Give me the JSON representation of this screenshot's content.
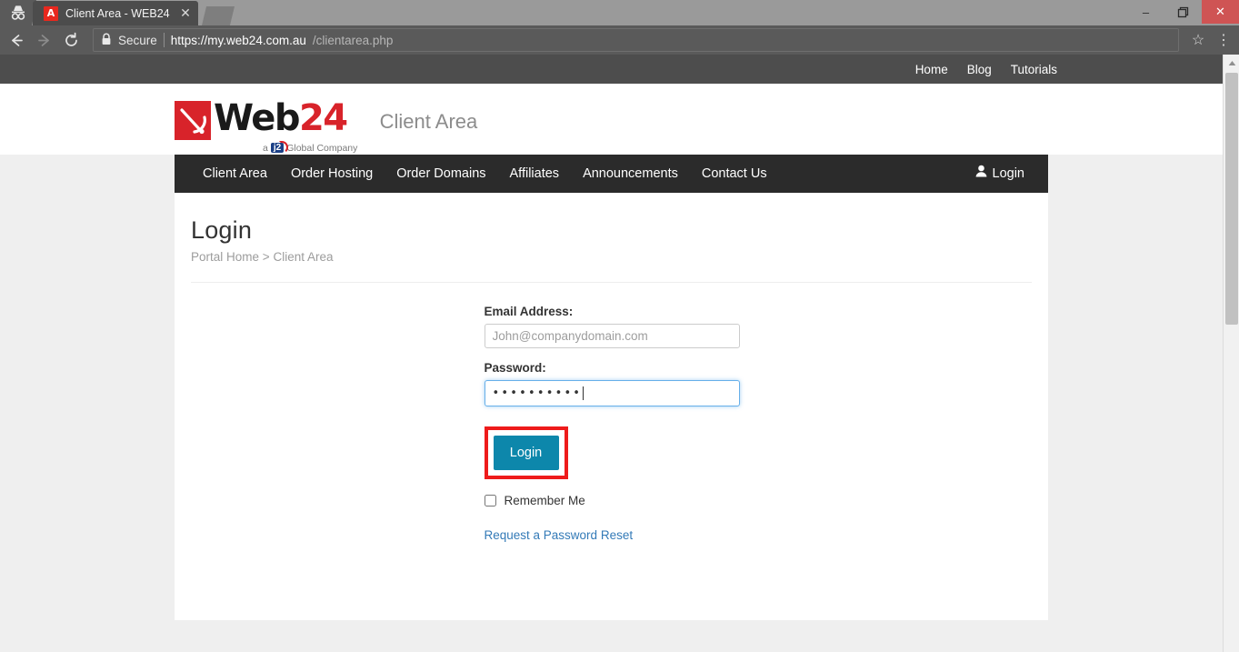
{
  "browser": {
    "incognito_icon": "incognito-icon",
    "tab": {
      "title": "Client Area - WEB24",
      "favicon_glyph": "A",
      "close_glyph": "✕"
    },
    "new_tab_label": "",
    "window_controls": {
      "minimize": "–",
      "restore": "❐",
      "close": "✕"
    },
    "toolbar": {
      "back_glyph": "←",
      "forward_glyph": "→",
      "reload_glyph": "⟳",
      "security_label": "Secure",
      "url_host": "https://my.web24.com.au",
      "url_path": "/clientarea.php",
      "bookmark_glyph": "☆",
      "menu_glyph": "⋮"
    }
  },
  "topbar": {
    "links": [
      {
        "label": "Home"
      },
      {
        "label": "Blog"
      },
      {
        "label": "Tutorials"
      }
    ]
  },
  "header": {
    "logo_web": "Web",
    "logo_24": "24",
    "logo_sub_prefix": "a",
    "logo_sub_badge": "j2",
    "logo_sub_suffix": "Global Company",
    "site_label": "Client Area"
  },
  "mainnav": {
    "items": [
      {
        "label": "Client Area"
      },
      {
        "label": "Order Hosting"
      },
      {
        "label": "Order Domains"
      },
      {
        "label": "Affiliates"
      },
      {
        "label": "Announcements"
      },
      {
        "label": "Contact Us"
      }
    ],
    "login": {
      "label": "Login",
      "icon": "user-icon"
    }
  },
  "page": {
    "title": "Login",
    "breadcrumb": {
      "home": "Portal Home",
      "separator": ">",
      "current": "Client Area"
    }
  },
  "form": {
    "email_label": "Email Address:",
    "email_value": "",
    "email_placeholder": "John@companydomain.com",
    "password_label": "Password:",
    "password_masked": "••••••••••",
    "submit_label": "Login",
    "remember_label": "Remember Me",
    "remember_checked": false,
    "reset_link": "Request a Password Reset"
  },
  "colors": {
    "accent_button": "#0d87ab",
    "annotation_box": "#ee1b1b",
    "brand_red": "#d8232a",
    "nav_dark": "#2b2b2b",
    "topbar_gray": "#4d4d4d",
    "link_blue": "#337ab7"
  }
}
